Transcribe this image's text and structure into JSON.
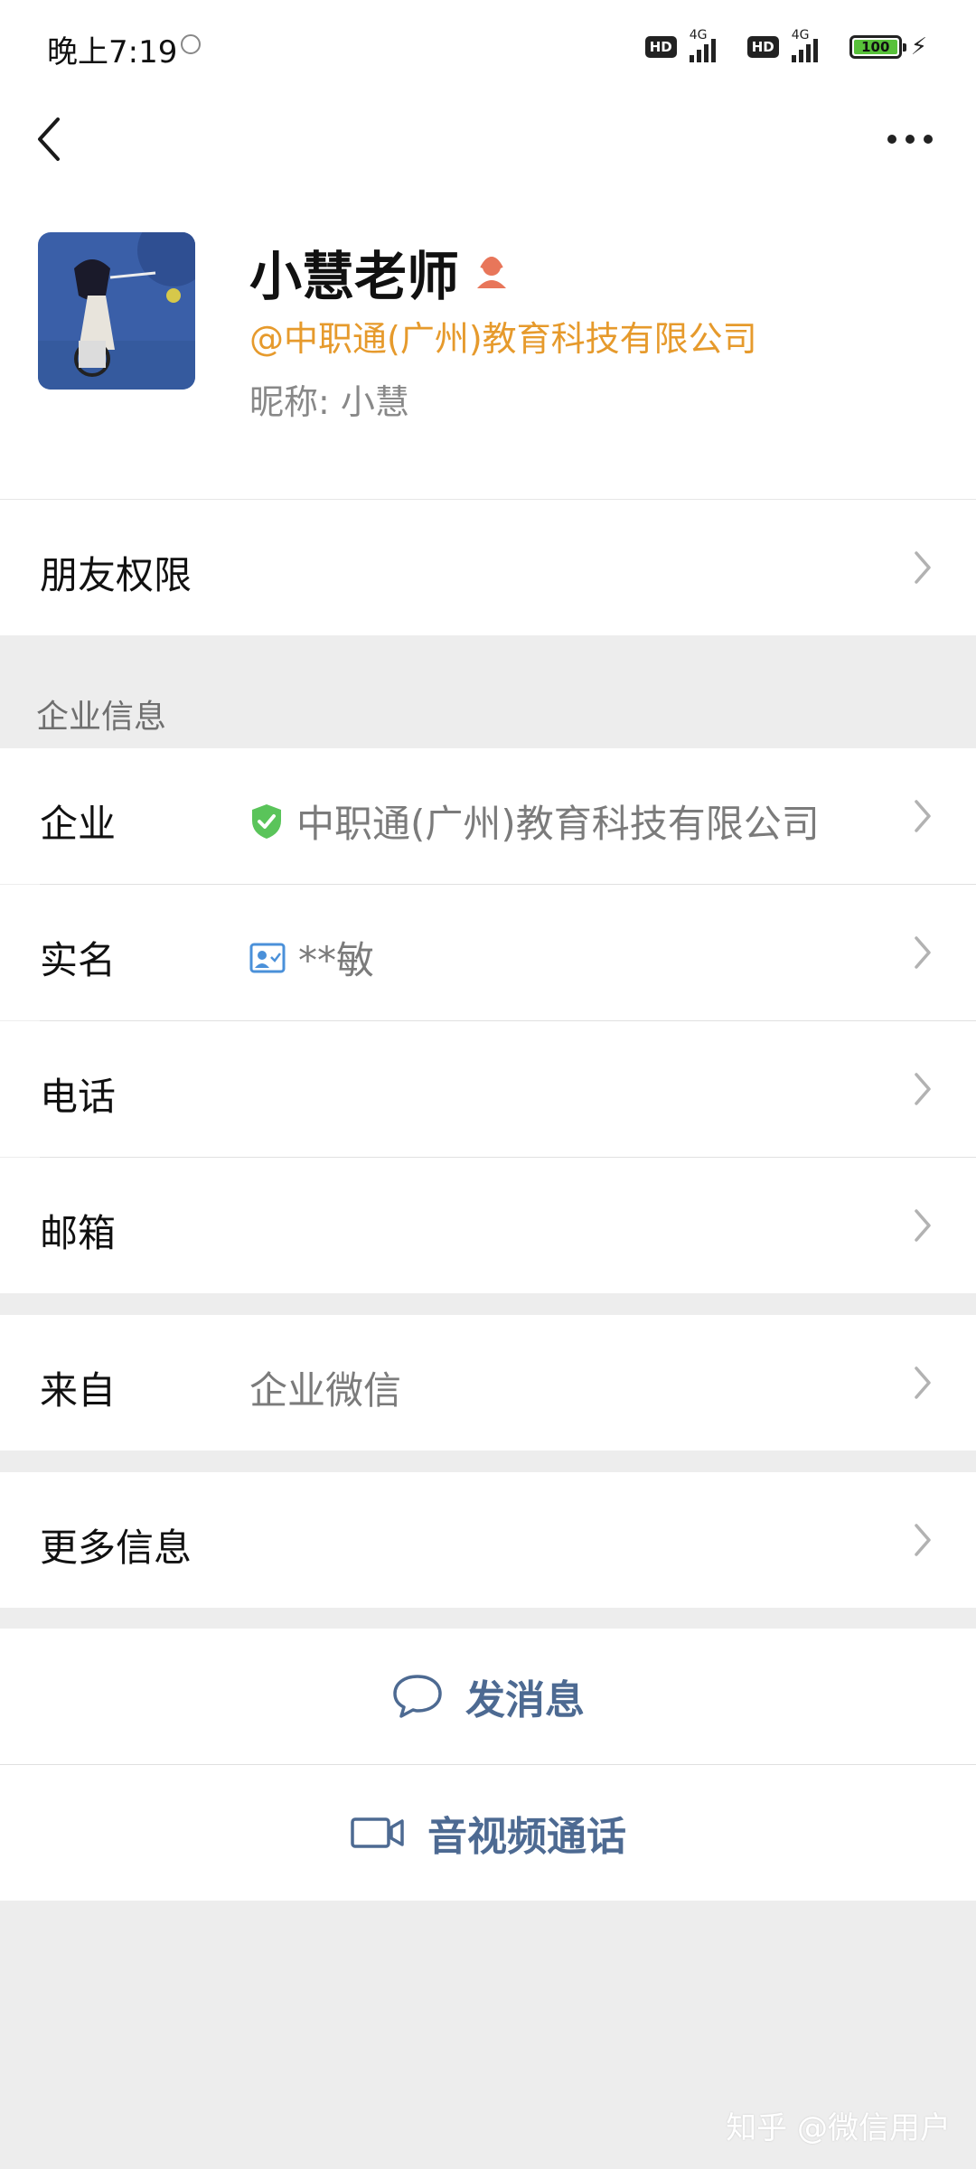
{
  "status_bar": {
    "time": "晚上7:19",
    "hd_label": "HD",
    "network_label": "4G",
    "battery": "100"
  },
  "profile": {
    "name": "小慧老师",
    "company": "@中职通(广州)教育科技有限公司",
    "nickname": "昵称:  小慧"
  },
  "friend_permission": {
    "label": "朋友权限"
  },
  "enterprise_section": {
    "title": "企业信息",
    "rows": [
      {
        "label": "企业",
        "value": "中职通(广州)教育科技有限公司"
      },
      {
        "label": "实名",
        "value": "**敏"
      },
      {
        "label": "电话",
        "value": ""
      },
      {
        "label": "邮箱",
        "value": ""
      }
    ]
  },
  "source": {
    "label": "来自",
    "value": "企业微信"
  },
  "more_info": {
    "label": "更多信息"
  },
  "actions": {
    "message": "发消息",
    "av_call": "音视频通话"
  },
  "watermark": "知乎 @微信用户",
  "colors": {
    "accent_orange": "#e69a2c",
    "link_blue": "#4d6a92",
    "verified_green": "#5ac45a",
    "background": "#ededed"
  }
}
